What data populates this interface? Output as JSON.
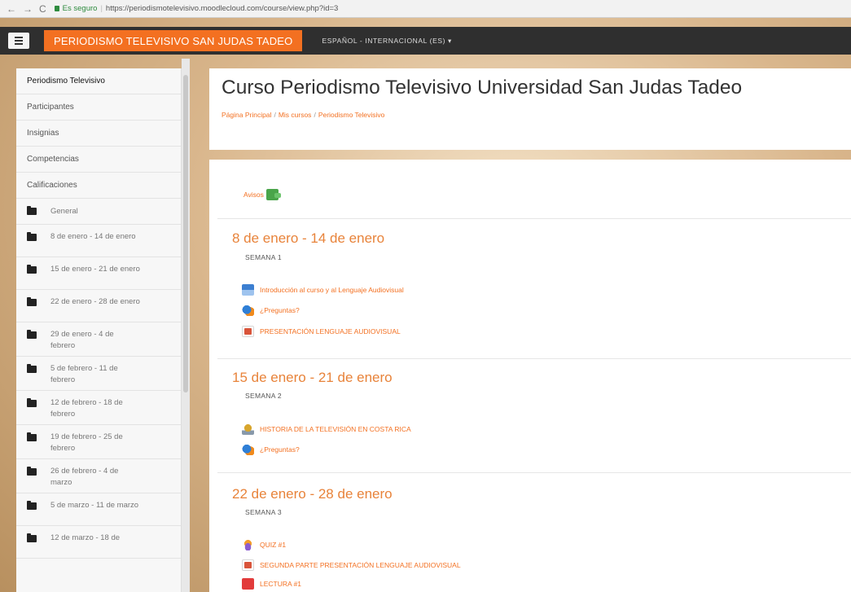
{
  "browser": {
    "secure_label": "Es seguro",
    "url": "https://periodismotelevisivo.moodlecloud.com/course/view.php?id=3"
  },
  "navbar": {
    "site_name": "PERIODISMO TELEVISIVO SAN JUDAS TADEO",
    "language": "ESPAÑOL - INTERNACIONAL (ES) ▾"
  },
  "sidebar": {
    "items": [
      {
        "label": "Periodismo Televisivo"
      },
      {
        "label": "Participantes"
      },
      {
        "label": "Insignias"
      },
      {
        "label": "Competencias"
      },
      {
        "label": "Calificaciones"
      }
    ],
    "weeks": [
      {
        "label": "General"
      },
      {
        "label": "8 de enero - 14 de enero"
      },
      {
        "label": "15 de enero - 21 de enero"
      },
      {
        "label": "22 de enero - 28 de enero"
      },
      {
        "label": "29 de enero - 4 de febrero"
      },
      {
        "label": "5 de febrero - 11 de febrero"
      },
      {
        "label": "12 de febrero - 18 de febrero"
      },
      {
        "label": "19 de febrero - 25 de febrero"
      },
      {
        "label": "26 de febrero - 4 de marzo"
      },
      {
        "label": "5 de marzo - 11 de marzo"
      },
      {
        "label": "12 de marzo - 18 de"
      }
    ]
  },
  "header": {
    "title": "Curso Periodismo Televisivo Universidad San Judas Tadeo",
    "breadcrumb": [
      "Página Principal",
      "Mis cursos",
      "Periodismo Televisivo"
    ]
  },
  "course": {
    "news": "Avisos",
    "sections": [
      {
        "title": "8 de enero - 14 de enero",
        "subtitle": "SEMANA 1",
        "activities": [
          {
            "label": "Introducción al curso y al Lenguaje Audiovisual",
            "icon": "lesson-icon"
          },
          {
            "label": "¿Preguntas?",
            "icon": "chat-icon"
          },
          {
            "label": "PRESENTACIÓN LENGUAJE AUDIOVISUAL",
            "icon": "resource-icon"
          }
        ]
      },
      {
        "title": "15 de enero - 21 de enero",
        "subtitle": "SEMANA 2",
        "activities": [
          {
            "label": "HISTORIA DE LA TELEVISIÓN EN COSTA RICA",
            "icon": "book-icon"
          },
          {
            "label": "¿Preguntas?",
            "icon": "chat-icon"
          }
        ]
      },
      {
        "title": "22 de enero - 28 de enero",
        "subtitle": "SEMANA 3",
        "activities": [
          {
            "label": "QUIZ #1",
            "icon": "quiz-icon"
          },
          {
            "label": "SEGUNDA PARTE PRESENTACIÓN LENGUAJE AUDIOVISUAL",
            "icon": "resource-icon"
          },
          {
            "label": "LECTURA #1",
            "icon": "pdf-icon"
          }
        ]
      }
    ]
  },
  "colors": {
    "accent": "#f37021",
    "navbar_bg": "#2f2f2f",
    "section_title": "#e8833a"
  }
}
